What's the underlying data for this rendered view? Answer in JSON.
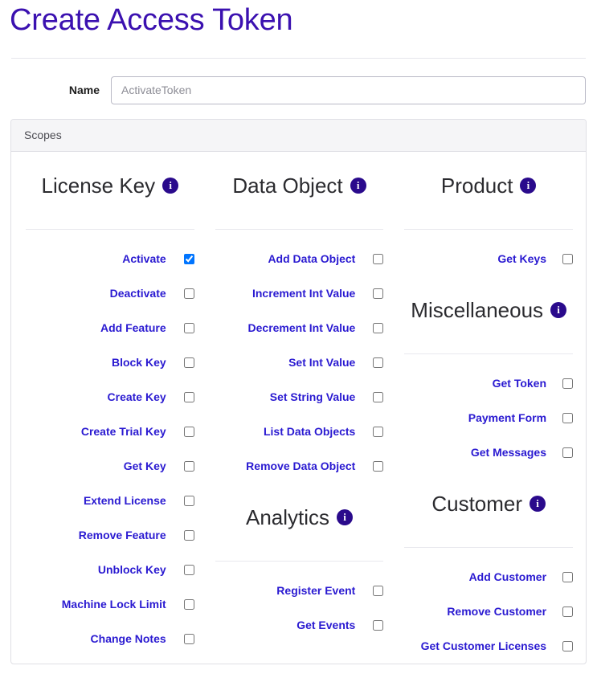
{
  "header": {
    "title": "Create Access Token"
  },
  "form": {
    "name_label": "Name",
    "name_value": "",
    "name_placeholder": "ActivateToken"
  },
  "scopes": {
    "panel_label": "Scopes",
    "info_icon_glyph": "i",
    "info_icon_name": "info-icon",
    "columns": [
      {
        "key": "left",
        "groups": [
          {
            "title": "License Key",
            "items": [
              {
                "label": "Activate",
                "checked": true
              },
              {
                "label": "Deactivate",
                "checked": false
              },
              {
                "label": "Add Feature",
                "checked": false
              },
              {
                "label": "Block Key",
                "checked": false
              },
              {
                "label": "Create Key",
                "checked": false
              },
              {
                "label": "Create Trial Key",
                "checked": false
              },
              {
                "label": "Get Key",
                "checked": false
              },
              {
                "label": "Extend License",
                "checked": false
              },
              {
                "label": "Remove Feature",
                "checked": false
              },
              {
                "label": "Unblock Key",
                "checked": false
              },
              {
                "label": "Machine Lock Limit",
                "checked": false
              },
              {
                "label": "Change Notes",
                "checked": false
              }
            ]
          }
        ]
      },
      {
        "key": "middle",
        "groups": [
          {
            "title": "Data Object",
            "items": [
              {
                "label": "Add Data Object",
                "checked": false
              },
              {
                "label": "Increment Int Value",
                "checked": false
              },
              {
                "label": "Decrement Int Value",
                "checked": false
              },
              {
                "label": "Set Int Value",
                "checked": false
              },
              {
                "label": "Set String Value",
                "checked": false
              },
              {
                "label": "List Data Objects",
                "checked": false
              },
              {
                "label": "Remove Data Object",
                "checked": false
              }
            ]
          },
          {
            "title": "Analytics",
            "items": [
              {
                "label": "Register Event",
                "checked": false
              },
              {
                "label": "Get Events",
                "checked": false
              }
            ]
          }
        ]
      },
      {
        "key": "right",
        "groups": [
          {
            "title": "Product",
            "items": [
              {
                "label": "Get Keys",
                "checked": false
              }
            ]
          },
          {
            "title": "Miscellaneous",
            "items": [
              {
                "label": "Get Token",
                "checked": false
              },
              {
                "label": "Payment Form",
                "checked": false
              },
              {
                "label": "Get Messages",
                "checked": false
              }
            ]
          },
          {
            "title": "Customer",
            "items": [
              {
                "label": "Add Customer",
                "checked": false
              },
              {
                "label": "Remove Customer",
                "checked": false
              },
              {
                "label": "Get Customer Licenses",
                "checked": false
              }
            ]
          }
        ]
      }
    ]
  },
  "colors": {
    "title": "#3b11b0",
    "scope_label": "#2a1ad1",
    "info_badge": "#2a0a8c",
    "panel_border": "#dfdfe5",
    "panel_header_bg": "#f5f5f7"
  }
}
